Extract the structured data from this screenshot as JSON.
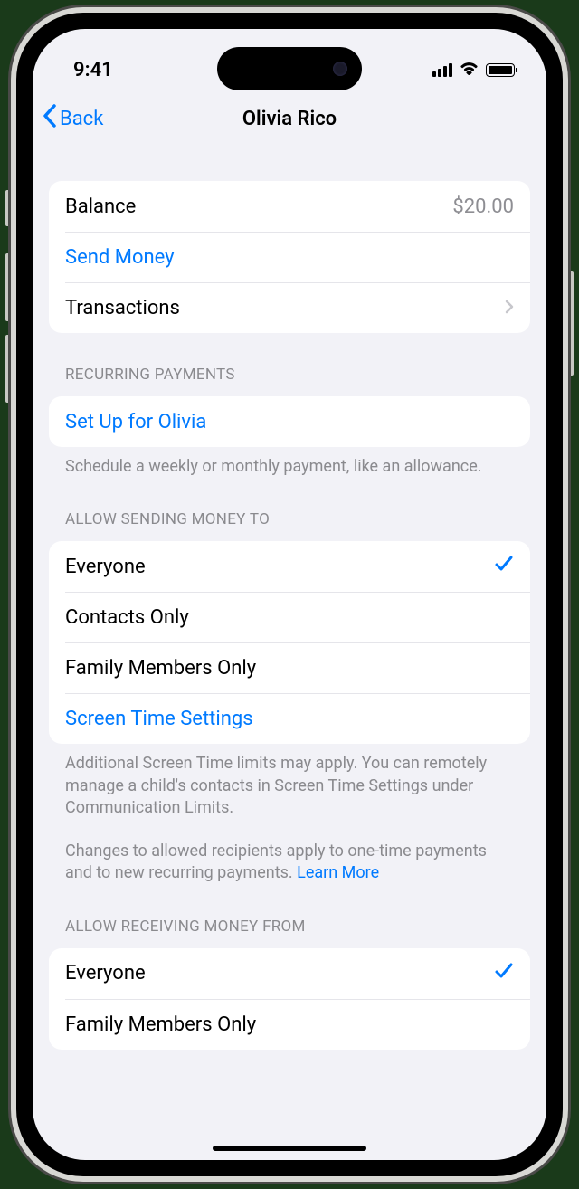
{
  "status": {
    "time": "9:41"
  },
  "nav": {
    "back": "Back",
    "title": "Olivia Rico"
  },
  "balance": {
    "label": "Balance",
    "value": "$20.00",
    "send": "Send Money",
    "transactions": "Transactions"
  },
  "recurring": {
    "header": "RECURRING PAYMENTS",
    "setup": "Set Up for Olivia",
    "footer": "Schedule a weekly or monthly payment, like an allowance."
  },
  "sending": {
    "header": "ALLOW SENDING MONEY TO",
    "options": {
      "everyone": "Everyone",
      "contacts": "Contacts Only",
      "family": "Family Members Only",
      "screentime": "Screen Time Settings"
    },
    "footer1": "Additional Screen Time limits may apply. You can remotely manage a child's contacts in Screen Time Settings under Communication Limits.",
    "footer2": "Changes to allowed recipients apply to one-time payments and to new recurring payments. ",
    "learnmore": "Learn More"
  },
  "receiving": {
    "header": "ALLOW RECEIVING MONEY FROM",
    "options": {
      "everyone": "Everyone",
      "family": "Family Members Only"
    }
  }
}
